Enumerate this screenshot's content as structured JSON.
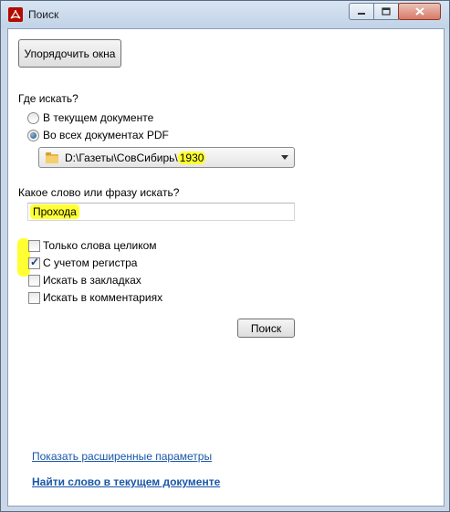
{
  "window": {
    "title": "Поиск",
    "icon": "adobe-acrobat-icon",
    "controls": {
      "minimize": "minimize-icon",
      "maximize": "maximize-icon",
      "close": "close-icon"
    },
    "highlight_color": "#ffff33"
  },
  "toolbar": {
    "arrange_windows_label": "Упорядочить окна"
  },
  "where": {
    "heading": "Где искать?",
    "options": [
      {
        "label": "В текущем документе",
        "selected": false
      },
      {
        "label": "Во всех документах PDF",
        "selected": true
      }
    ],
    "folder": {
      "path_prefix": "D:\\Газеты\\СовСибирь\\",
      "path_highlight": "1930",
      "icon": "folder-icon"
    }
  },
  "query": {
    "heading": "Какое слово или фразу искать?",
    "value": "Прохода"
  },
  "options": [
    {
      "label": "Только слова целиком",
      "checked": false
    },
    {
      "label": "С учетом регистра",
      "checked": true
    },
    {
      "label": "Искать в закладках",
      "checked": false
    },
    {
      "label": "Искать в комментариях",
      "checked": false
    }
  ],
  "search_button_label": "Поиск",
  "links": {
    "advanced": "Показать расширенные параметры",
    "find_current": "Найти слово в текущем документе"
  }
}
